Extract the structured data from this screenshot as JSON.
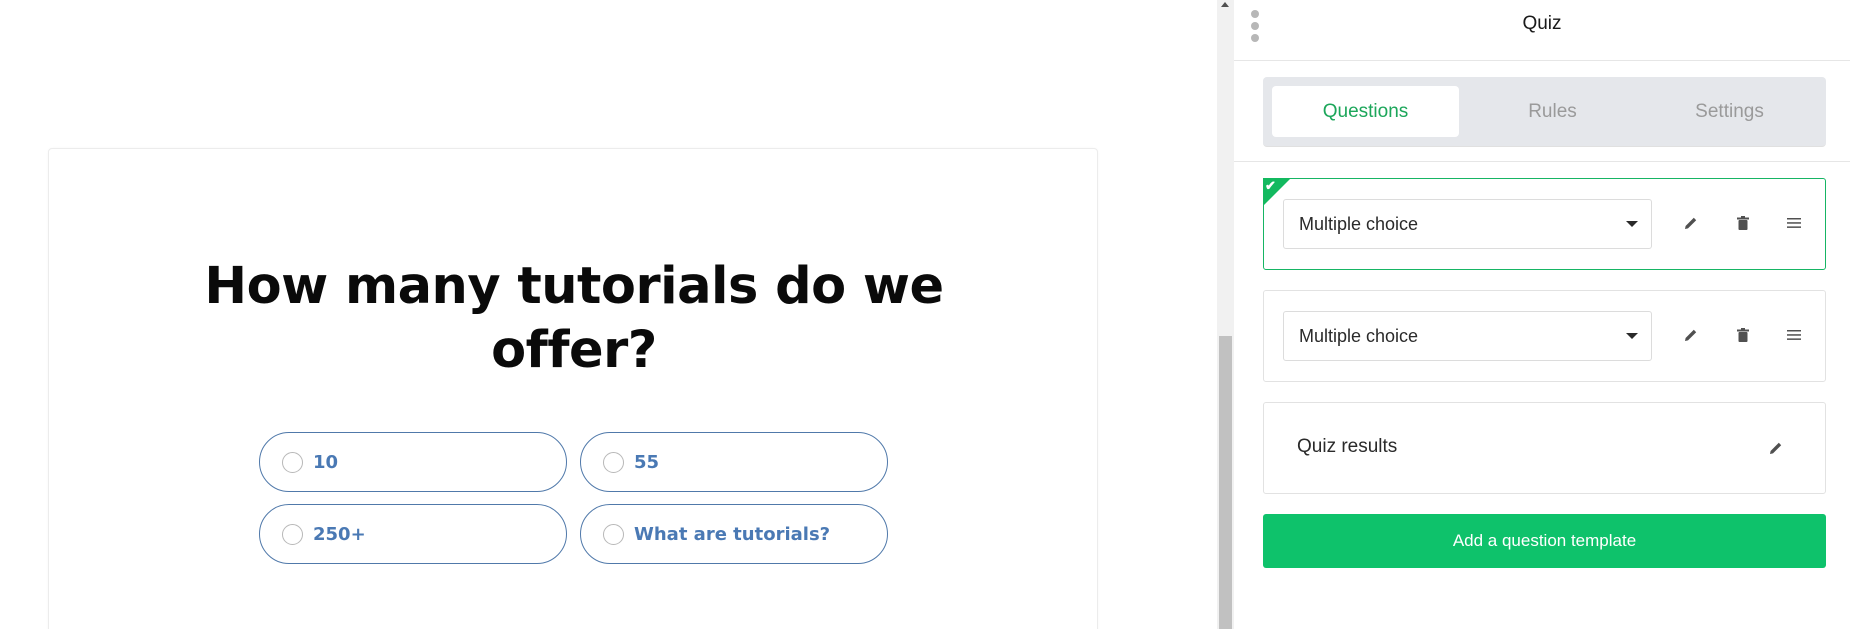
{
  "preview": {
    "question": "How many tutorials do we offer?",
    "answers": [
      {
        "label": "10"
      },
      {
        "label": "55"
      },
      {
        "label": "250+"
      },
      {
        "label": "What are tutorials?"
      }
    ]
  },
  "panel": {
    "title": "Quiz",
    "tabs": [
      {
        "label": "Questions",
        "active": true
      },
      {
        "label": "Rules",
        "active": false
      },
      {
        "label": "Settings",
        "active": false
      }
    ],
    "questions": [
      {
        "type": "Multiple choice",
        "selected": true
      },
      {
        "type": "Multiple choice",
        "selected": false
      }
    ],
    "results_label": "Quiz results",
    "add_button": "Add a question template"
  },
  "icons": {
    "drag": "drag-dots-icon",
    "edit": "pencil-icon",
    "delete": "trash-icon",
    "reorder": "hamburger-icon",
    "check": "check-icon",
    "dropdown": "caret-down-icon"
  },
  "colors": {
    "accent_green": "#0ec26b",
    "active_tab_text": "#1ca65a",
    "answer_border": "#5079aa",
    "answer_text": "#4a79b4"
  }
}
